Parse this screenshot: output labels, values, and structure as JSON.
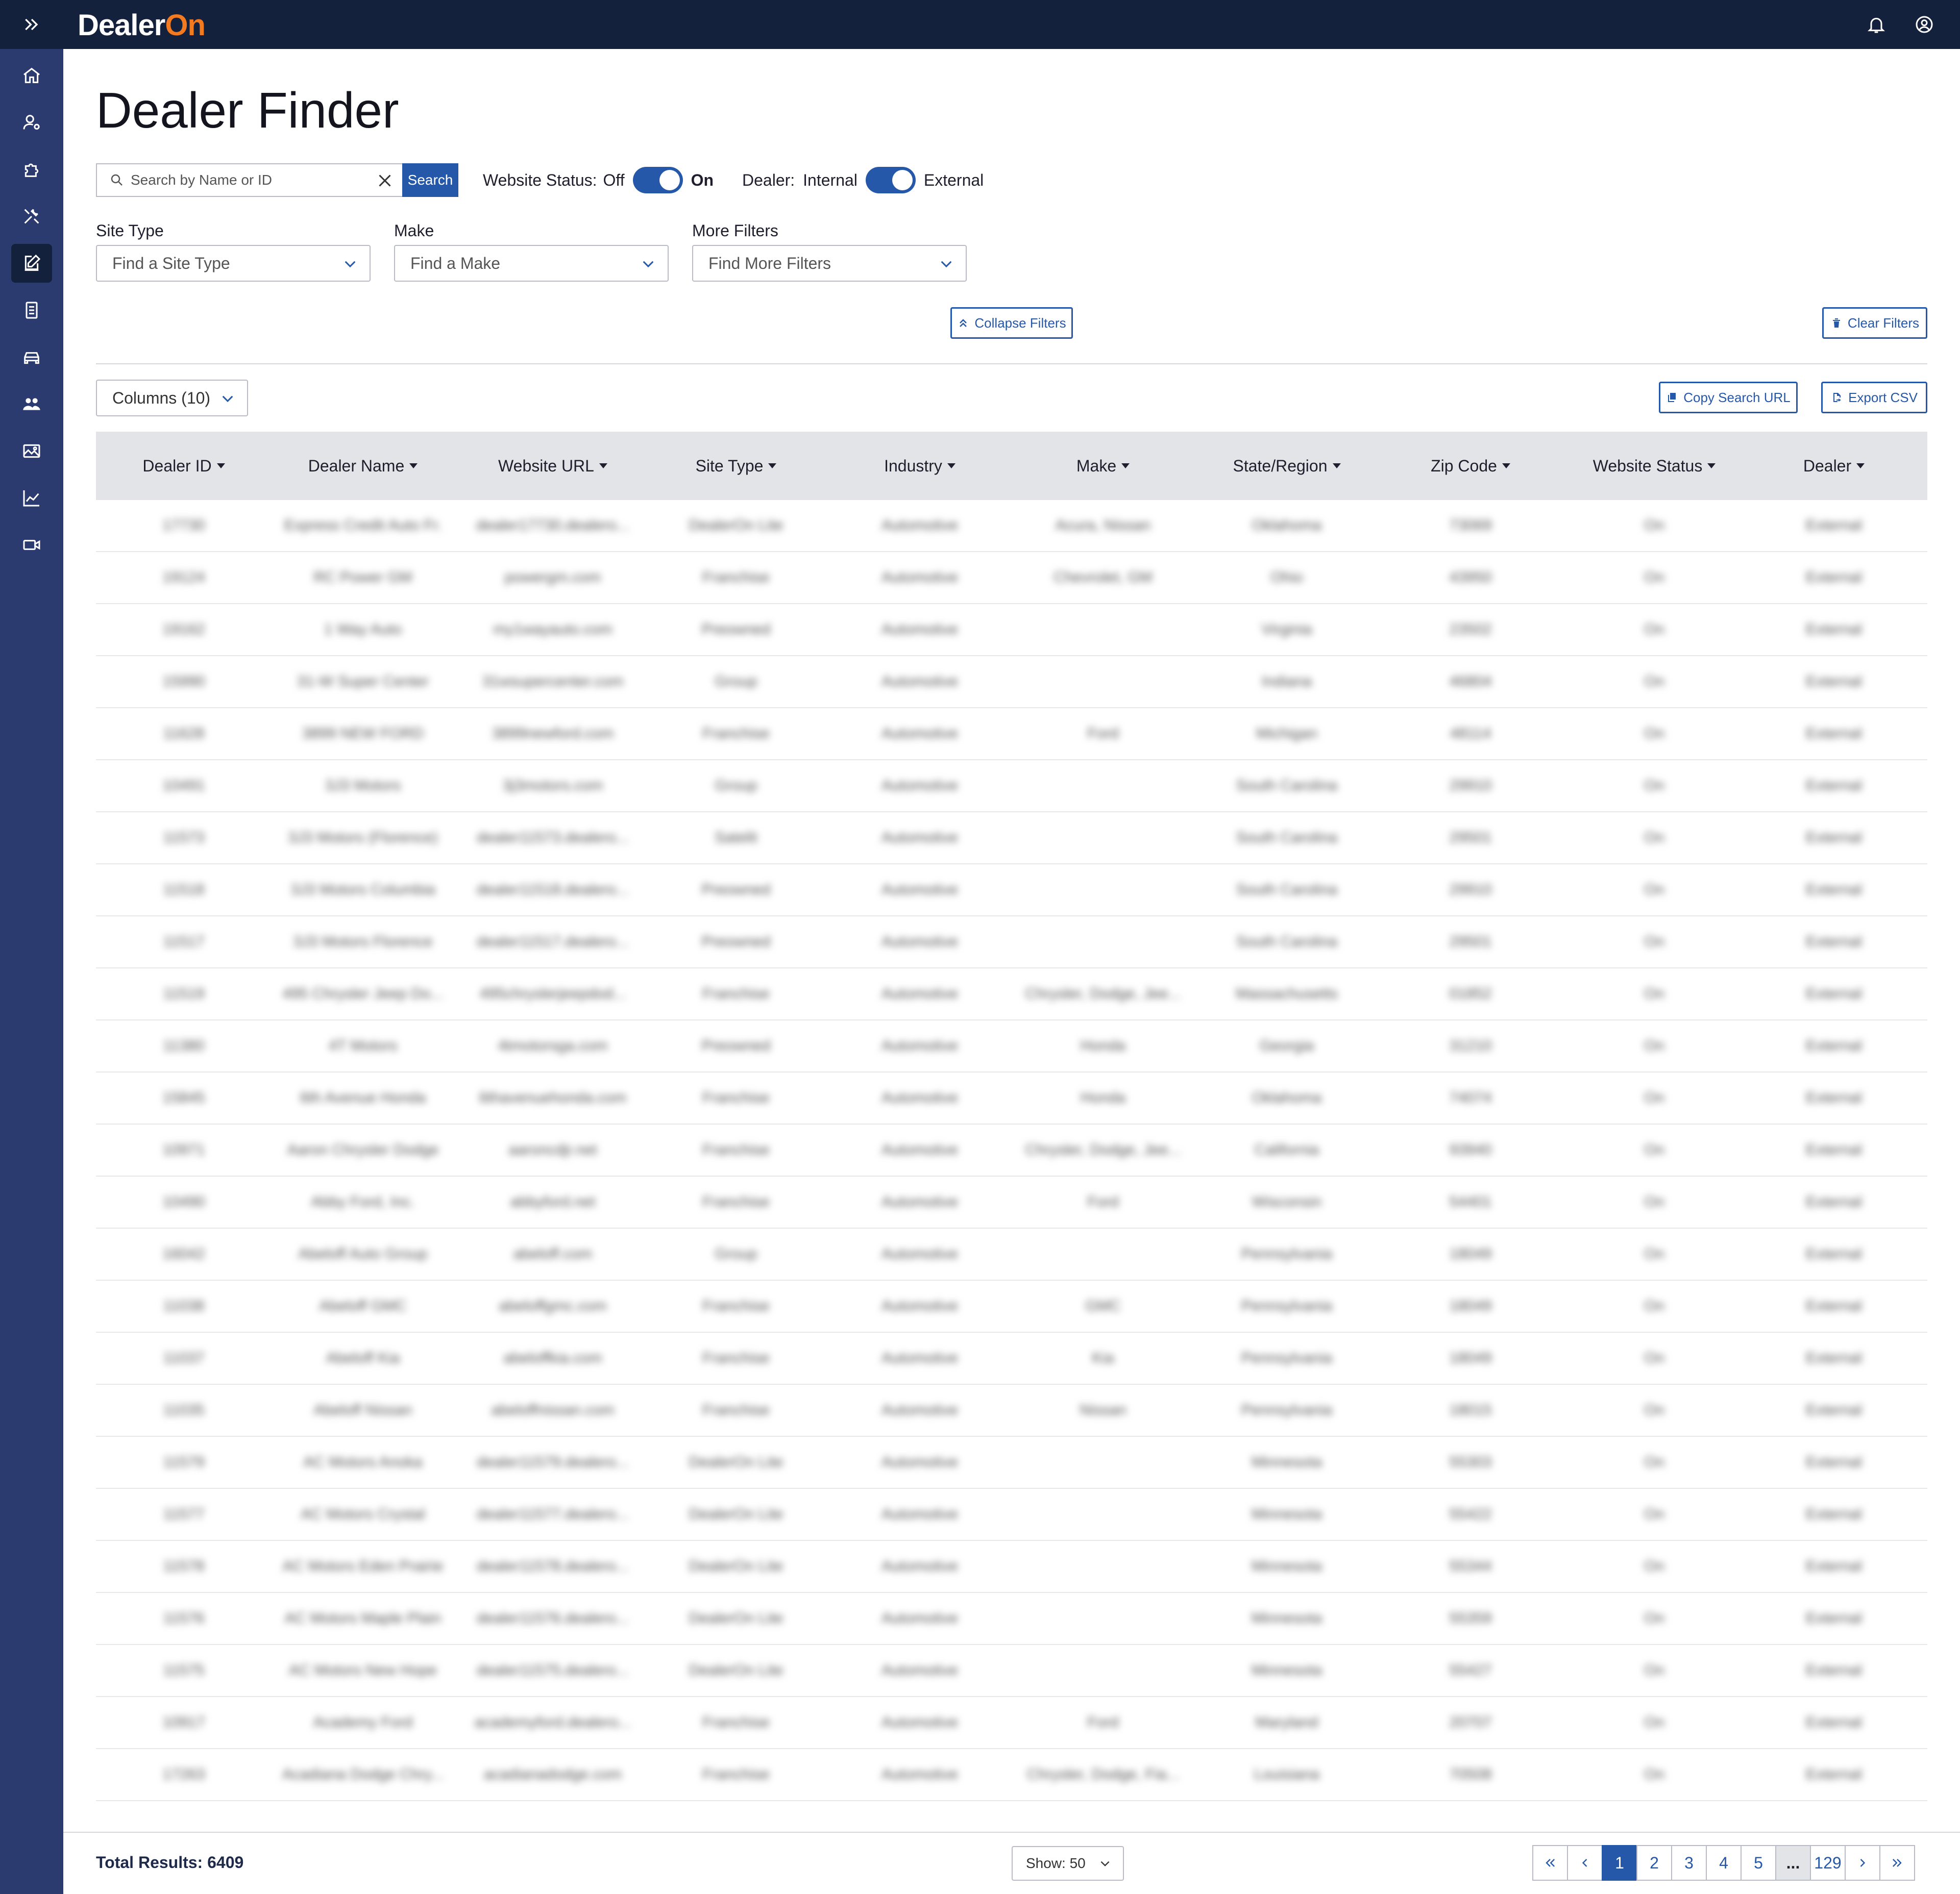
{
  "app": {
    "logo_text": "Dealer",
    "logo_accent": "On"
  },
  "colors": {
    "sidebar": "#2b3b6f",
    "topbar": "#14213d",
    "accent": "#2558a8",
    "brand_orange": "#f47a20"
  },
  "sidebar": {
    "items": [
      {
        "icon": "home-icon"
      },
      {
        "icon": "user-settings-icon"
      },
      {
        "icon": "puzzle-icon"
      },
      {
        "icon": "tools-icon"
      },
      {
        "icon": "edit-icon",
        "active": true
      },
      {
        "icon": "document-icon"
      },
      {
        "icon": "car-icon"
      },
      {
        "icon": "users-icon"
      },
      {
        "icon": "gallery-icon"
      },
      {
        "icon": "chart-icon"
      },
      {
        "icon": "video-icon"
      }
    ]
  },
  "page": {
    "title": "Dealer Finder"
  },
  "search": {
    "placeholder": "Search by Name or ID",
    "button": "Search"
  },
  "website_status_toggle": {
    "label": "Website Status:",
    "off": "Off",
    "on": "On"
  },
  "dealer_toggle": {
    "label": "Dealer:",
    "off": "Internal",
    "on": "External"
  },
  "filters": {
    "site_type": {
      "label": "Site Type",
      "placeholder": "Find a Site Type"
    },
    "make": {
      "label": "Make",
      "placeholder": "Find a Make"
    },
    "more": {
      "label": "More Filters",
      "placeholder": "Find More Filters"
    }
  },
  "buttons": {
    "collapse_filters": "Collapse Filters",
    "clear_filters": "Clear Filters",
    "columns": "Columns (10)",
    "copy_search_url": "Copy Search URL",
    "export_csv": "Export CSV"
  },
  "table": {
    "columns": [
      "Dealer ID",
      "Dealer Name",
      "Website URL",
      "Site Type",
      "Industry",
      "Make",
      "State/Region",
      "Zip Code",
      "Website Status",
      "Dealer"
    ],
    "rows": [
      [
        "17730",
        "Express Credit Auto Fr.",
        "dealer17730.dealero...",
        "DealerOn Lite",
        "Automotive",
        "Acura, Nissan",
        "Oklahoma",
        "73069",
        "On",
        "External"
      ],
      [
        "19124",
        "RC Power GM",
        "powergm.com",
        "Franchise",
        "Automotive",
        "Chevrolet, GM",
        "Ohio",
        "43950",
        "On",
        "External"
      ],
      [
        "19162",
        "1 Way Auto",
        "my1wayauto.com",
        "Preowned",
        "Automotive",
        "",
        "Virginia",
        "23502",
        "On",
        "External"
      ],
      [
        "15990",
        "31-W Super Center",
        "31wsupercenter.com",
        "Group",
        "Automotive",
        "",
        "Indiana",
        "46804",
        "On",
        "External"
      ],
      [
        "11628",
        "3899 NEW FORD",
        "3899newford.com",
        "Franchise",
        "Automotive",
        "Ford",
        "Michigan",
        "48114",
        "On",
        "External"
      ],
      [
        "10491",
        "3J3 Motors",
        "3j3motors.com",
        "Group",
        "Automotive",
        "",
        "South Carolina",
        "29910",
        "On",
        "External"
      ],
      [
        "11573",
        "3J3 Motors (Florence)",
        "dealer11573.dealero...",
        "Satelit",
        "Automotive",
        "",
        "South Carolina",
        "29501",
        "On",
        "External"
      ],
      [
        "11518",
        "3J3 Motors Columbia",
        "dealer11518.dealero...",
        "Preowned",
        "Automotive",
        "",
        "South Carolina",
        "29910",
        "On",
        "External"
      ],
      [
        "11517",
        "3J3 Motors Florence",
        "dealer11517.dealero...",
        "Preowned",
        "Automotive",
        "",
        "South Carolina",
        "29501",
        "On",
        "External"
      ],
      [
        "11519",
        "495 Chrysler Jeep Do...",
        "495chryslerjeepdod...",
        "Franchise",
        "Automotive",
        "Chrysler, Dodge, Jee...",
        "Massachusetts",
        "01852",
        "On",
        "External"
      ],
      [
        "11380",
        "4T Motors",
        "4tmotorsga.com",
        "Preowned",
        "Automotive",
        "Honda",
        "Georgia",
        "31210",
        "On",
        "External"
      ],
      [
        "15845",
        "6th Avenue Honda",
        "6thavenuehonda.com",
        "Franchise",
        "Automotive",
        "Honda",
        "Oklahoma",
        "74074",
        "On",
        "External"
      ],
      [
        "10971",
        "Aaron Chrysler Dodge",
        "aaroncdjr.net",
        "Franchise",
        "Automotive",
        "Chrysler, Dodge, Jee...",
        "California",
        "93940",
        "On",
        "External"
      ],
      [
        "10490",
        "Abby Ford, Inc.",
        "abbyford.net",
        "Franchise",
        "Automotive",
        "Ford",
        "Wisconsin",
        "54401",
        "On",
        "External"
      ],
      [
        "16042",
        "Abeloff Auto Group",
        "abeloff.com",
        "Group",
        "Automotive",
        "",
        "Pennsylvania",
        "18049",
        "On",
        "External"
      ],
      [
        "11038",
        "Abeloff GMC",
        "abeloffgmc.com",
        "Franchise",
        "Automotive",
        "GMC",
        "Pennsylvania",
        "18049",
        "On",
        "External"
      ],
      [
        "11037",
        "Abeloff Kia",
        "abeloffkia.com",
        "Franchise",
        "Automotive",
        "Kia",
        "Pennsylvania",
        "18049",
        "On",
        "External"
      ],
      [
        "11035",
        "Abeloff Nissan",
        "abeloffnissan.com",
        "Franchise",
        "Automotive",
        "Nissan",
        "Pennsylvania",
        "18015",
        "On",
        "External"
      ],
      [
        "11579",
        "AC Motors Anoka",
        "dealer11579.dealero...",
        "DealerOn Lite",
        "Automotive",
        "",
        "Minnesota",
        "55303",
        "On",
        "External"
      ],
      [
        "11577",
        "AC Motors Crystal",
        "dealer11577.dealero...",
        "DealerOn Lite",
        "Automotive",
        "",
        "Minnesota",
        "55422",
        "On",
        "External"
      ],
      [
        "11578",
        "AC Motors Eden Prairie",
        "dealer11578.dealero...",
        "DealerOn Lite",
        "Automotive",
        "",
        "Minnesota",
        "55344",
        "On",
        "External"
      ],
      [
        "11576",
        "AC Motors Maple Plain",
        "dealer11576.dealero...",
        "DealerOn Lite",
        "Automotive",
        "",
        "Minnesota",
        "55359",
        "On",
        "External"
      ],
      [
        "11575",
        "AC Motors New Hope",
        "dealer11575.dealero...",
        "DealerOn Lite",
        "Automotive",
        "",
        "Minnesota",
        "55427",
        "On",
        "External"
      ],
      [
        "10917",
        "Academy Ford",
        "academyford.dealero...",
        "Franchise",
        "Automotive",
        "Ford",
        "Maryland",
        "20707",
        "On",
        "External"
      ],
      [
        "17263",
        "Acadiana Dodge Chry...",
        "acadianadodge.com",
        "Franchise",
        "Automotive",
        "Chrysler, Dodge, Fia...",
        "Louisiana",
        "70508",
        "On",
        "External"
      ]
    ]
  },
  "footer": {
    "total_results": "Total Results: 6409",
    "show": "Show: 50",
    "pages": [
      "1",
      "2",
      "3",
      "4",
      "5",
      "...",
      "129"
    ]
  }
}
